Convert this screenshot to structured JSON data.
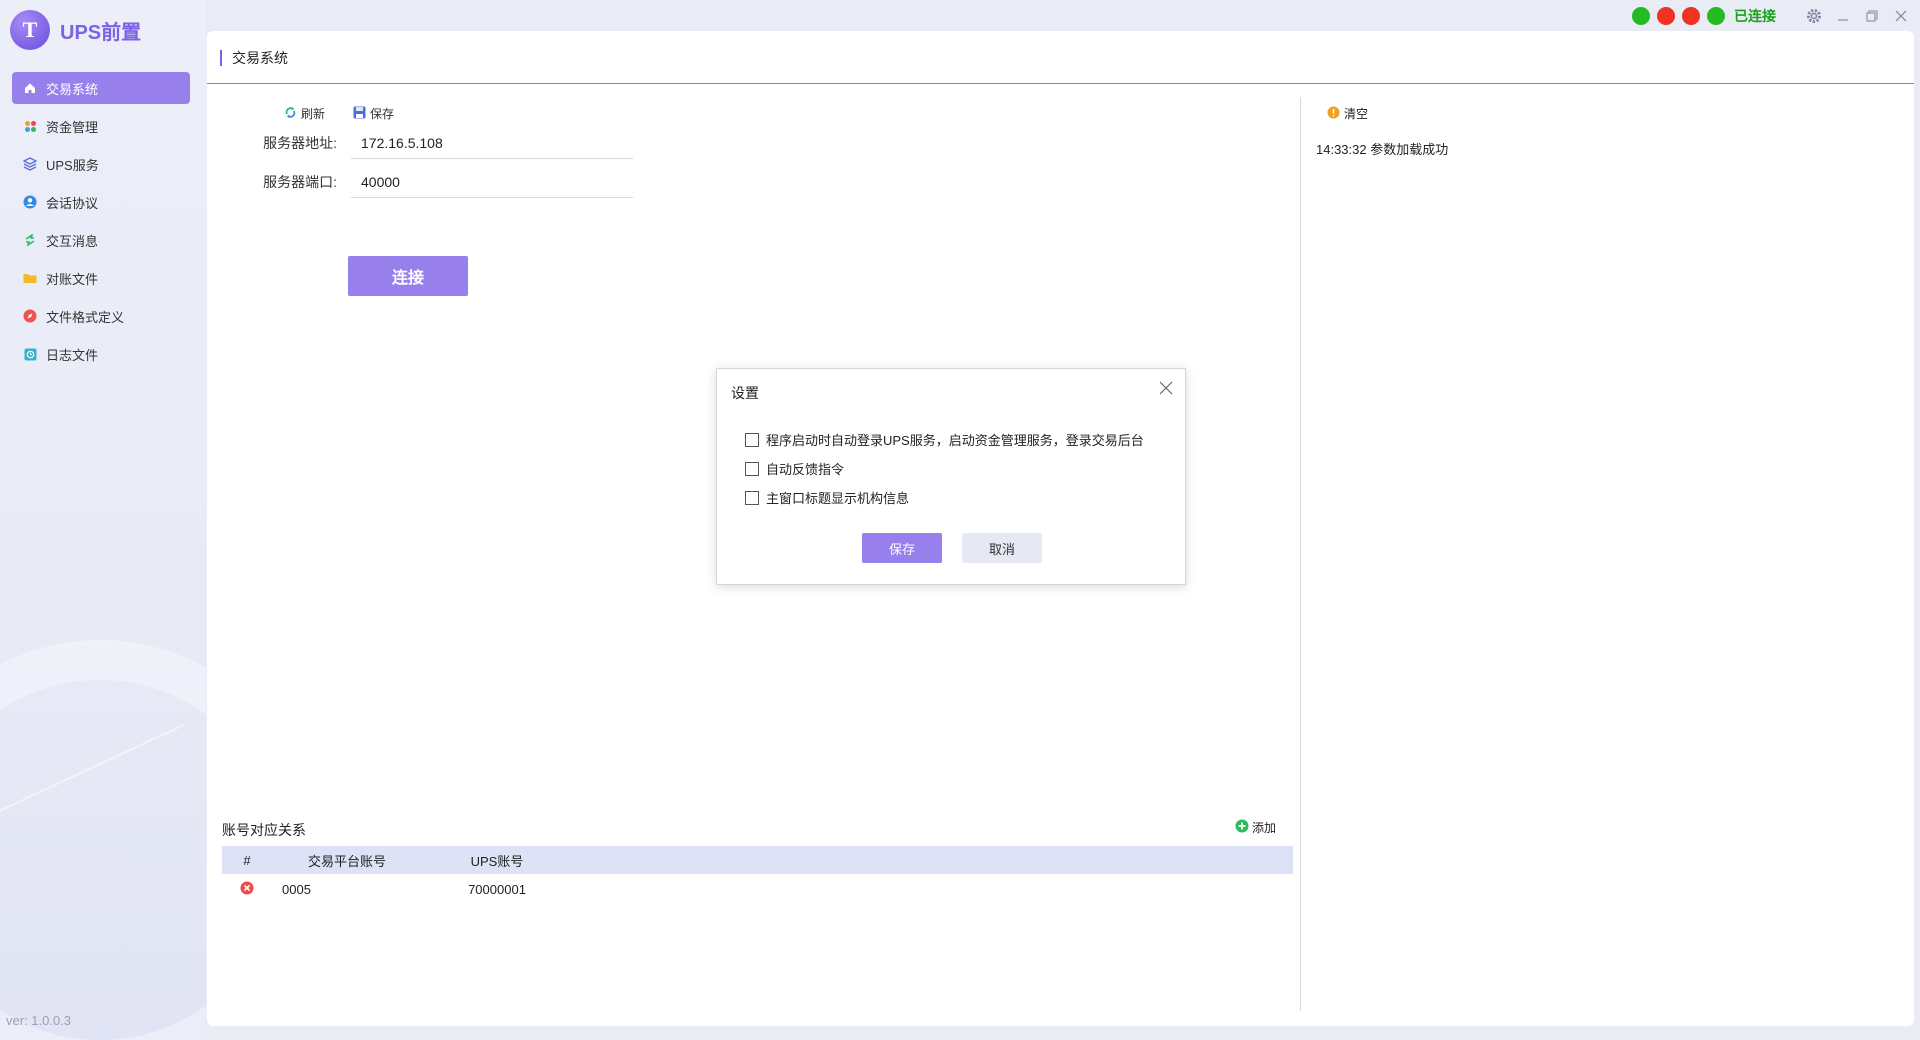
{
  "app": {
    "name": "UPS前置",
    "logo_letter": "T",
    "version": "ver: 1.0.0.3",
    "connection_status": "已连接",
    "status_dots": [
      "#22bb22",
      "#ee3322",
      "#ee3322",
      "#22bb22"
    ],
    "accent": "#9880ec"
  },
  "sidebar": {
    "items": [
      {
        "label": "交易系统",
        "icon": "home-icon",
        "active": true
      },
      {
        "label": "资金管理",
        "icon": "grid-icon"
      },
      {
        "label": "UPS服务",
        "icon": "layers-icon"
      },
      {
        "label": "会话协议",
        "icon": "user-circle-icon"
      },
      {
        "label": "交互消息",
        "icon": "exchange-icon"
      },
      {
        "label": "对账文件",
        "icon": "folder-icon"
      },
      {
        "label": "文件格式定义",
        "icon": "compass-icon"
      },
      {
        "label": "日志文件",
        "icon": "log-icon"
      }
    ]
  },
  "page": {
    "title": "交易系统",
    "toolbar": {
      "refresh_label": "刷新",
      "save_label": "保存"
    },
    "form": {
      "host_label": "服务器地址:",
      "host_value": "172.16.5.108",
      "port_label": "服务器端口:",
      "port_value": "40000",
      "connect_label": "连接"
    },
    "accounts": {
      "title": "账号对应关系",
      "add_label": "添加",
      "columns": [
        "#",
        "交易平台账号",
        "UPS账号"
      ],
      "rows": [
        {
          "trade_account": "0005",
          "ups_account": "70000001"
        }
      ]
    },
    "log": {
      "clear_label": "清空",
      "lines": [
        "14:33:32 参数加载成功"
      ]
    }
  },
  "dialog": {
    "title": "设置",
    "options": [
      {
        "label": "程序启动时自动登录UPS服务，启动资金管理服务，登录交易后台",
        "checked": false
      },
      {
        "label": "自动反馈指令",
        "checked": false
      },
      {
        "label": "主窗口标题显示机构信息",
        "checked": false
      }
    ],
    "save_label": "保存",
    "cancel_label": "取消"
  }
}
